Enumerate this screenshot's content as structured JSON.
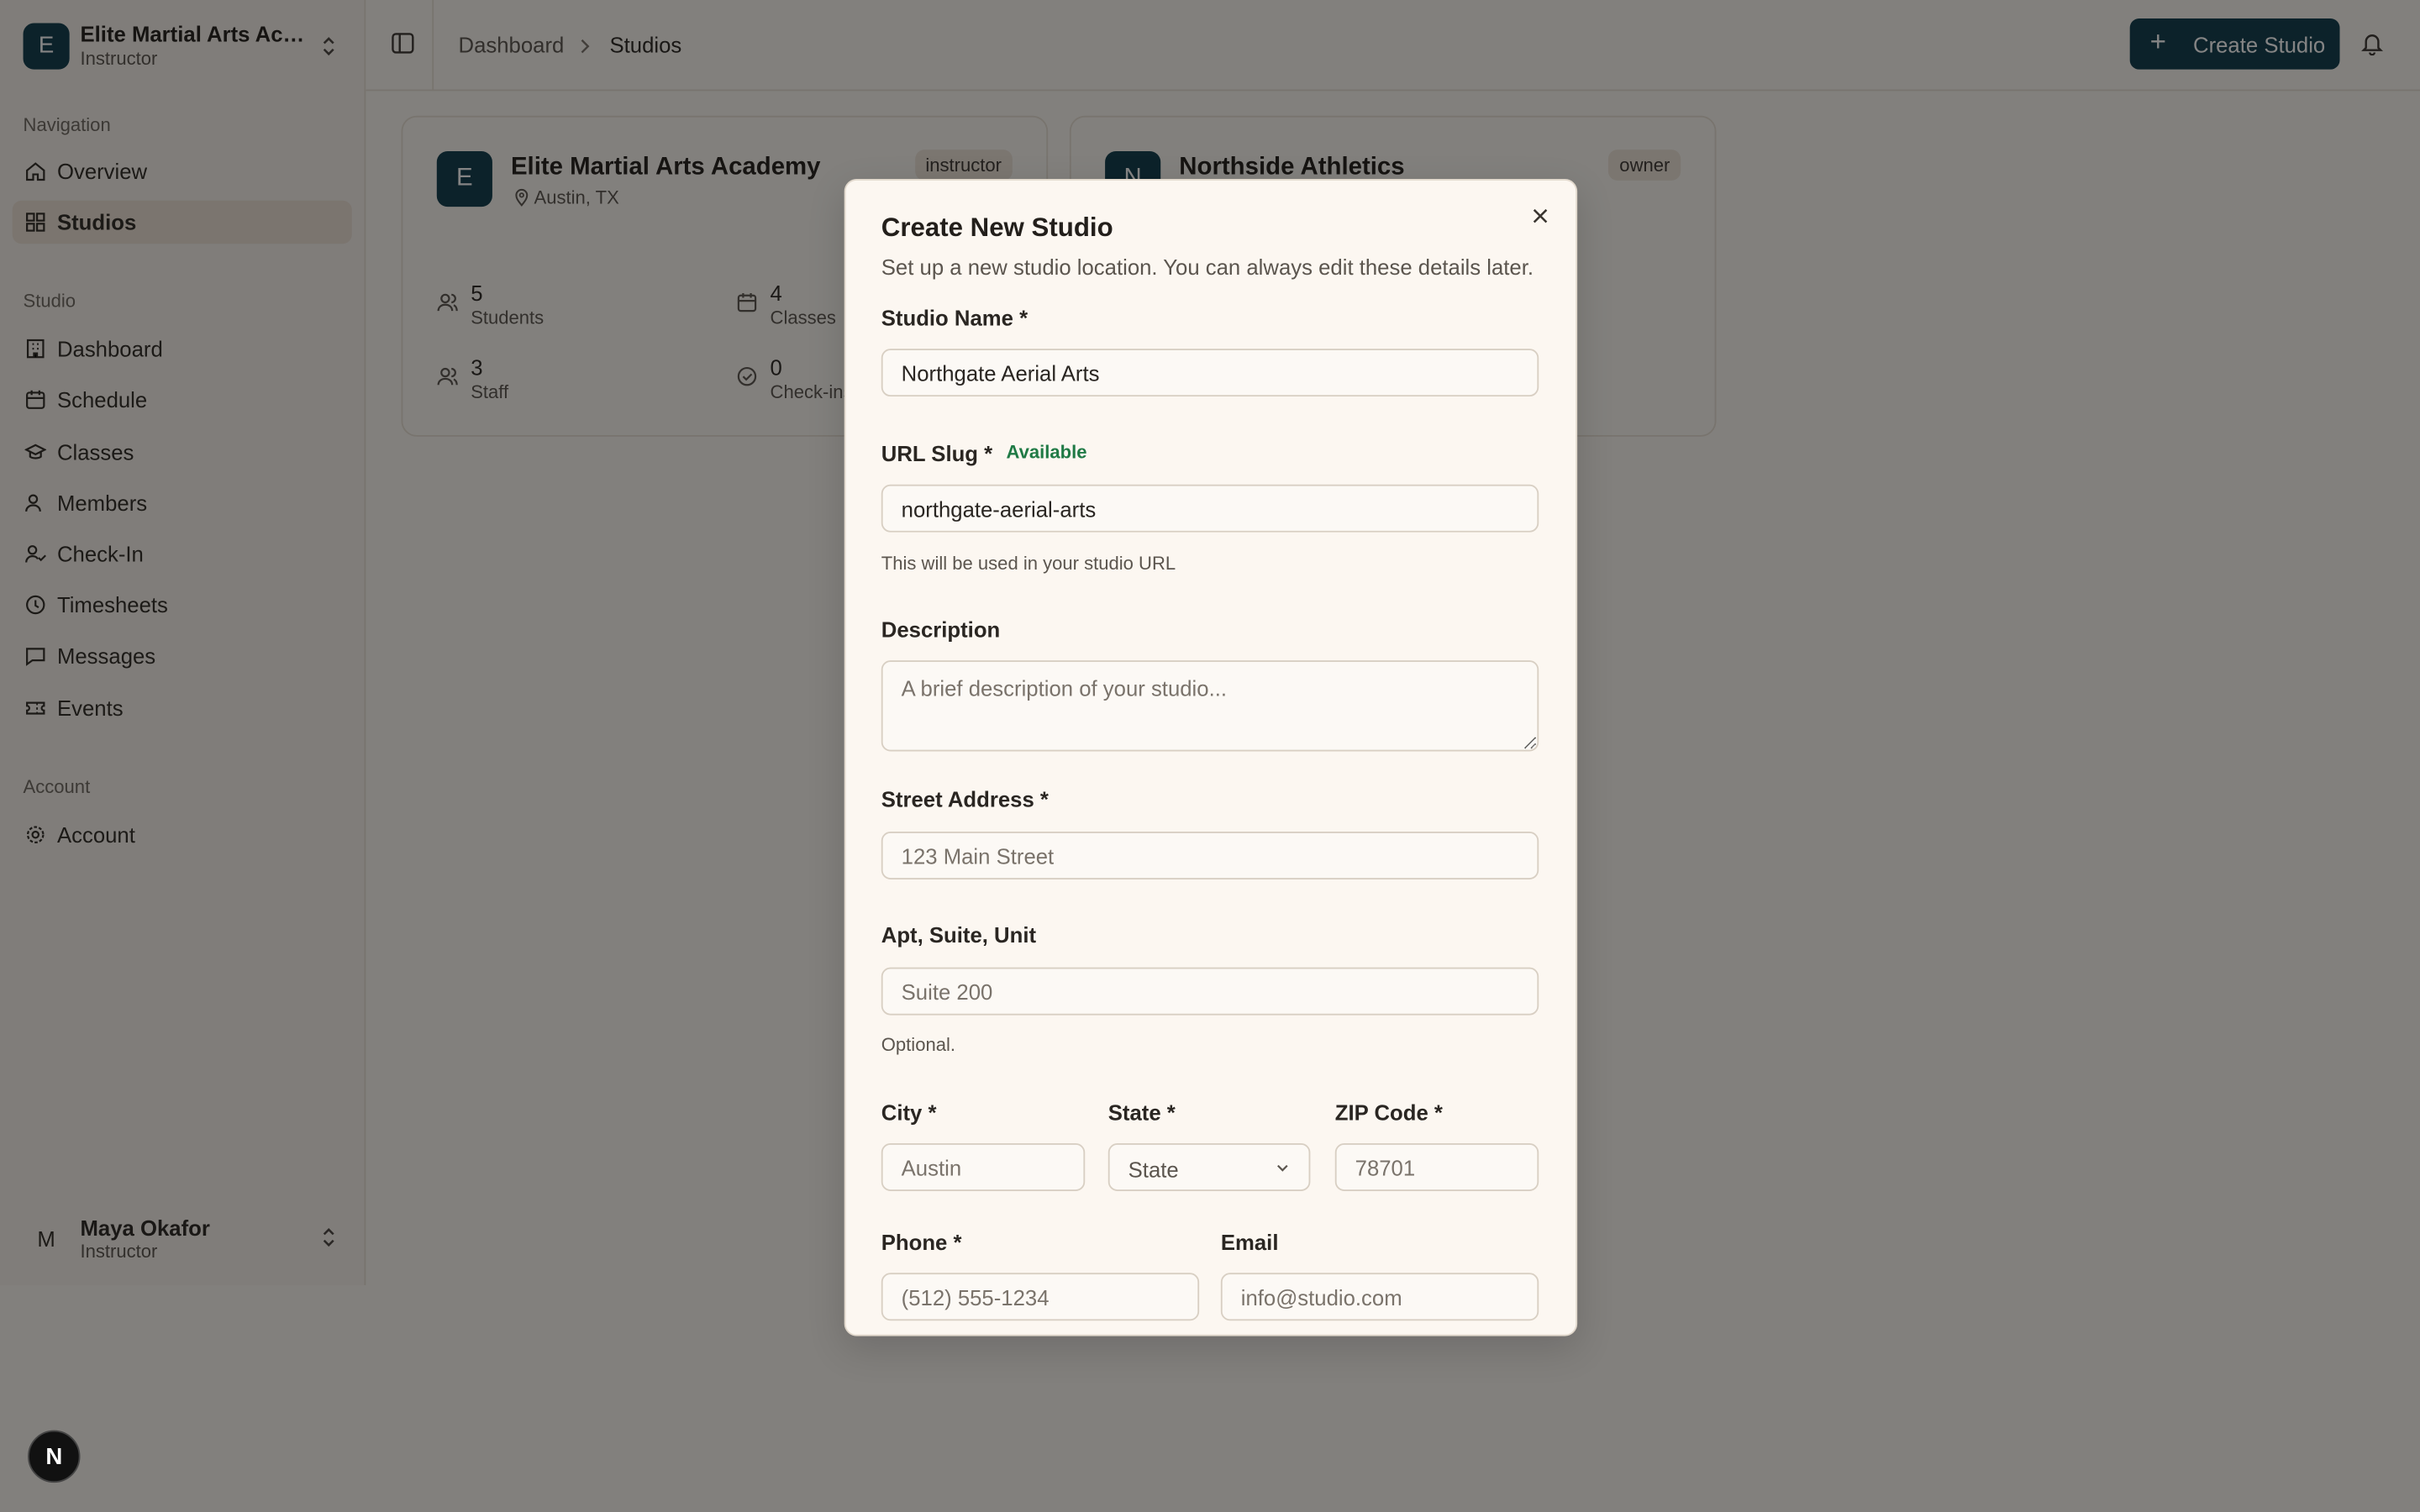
{
  "org": {
    "name": "Elite Martial Arts Aca...",
    "role": "Instructor",
    "initial": "E"
  },
  "nav": {
    "group_navigation": "Navigation",
    "overview": "Overview",
    "studios": "Studios",
    "group_studio": "Studio",
    "dashboard": "Dashboard",
    "schedule": "Schedule",
    "classes": "Classes",
    "members": "Members",
    "checkin": "Check-In",
    "timesheets": "Timesheets",
    "messages": "Messages",
    "events": "Events",
    "group_account": "Account",
    "account": "Account"
  },
  "user": {
    "name": "Maya Okafor",
    "role": "Instructor",
    "initial": "M"
  },
  "breadcrumb": {
    "root": "Dashboard",
    "current": "Studios"
  },
  "header": {
    "create_label": "Create Studio"
  },
  "cards": [
    {
      "initial": "E",
      "title": "Elite Martial Arts Academy",
      "location": "Austin, TX",
      "badge": "instructor",
      "stats": [
        {
          "num": "5",
          "cap": "Students"
        },
        {
          "num": "4",
          "cap": "Classes"
        },
        {
          "num": "3",
          "cap": "Staff"
        },
        {
          "num": "0",
          "cap": "Check-ins"
        }
      ]
    },
    {
      "initial": "N",
      "title": "Northside Athletics",
      "badge": "owner"
    }
  ],
  "modal": {
    "title": "Create New Studio",
    "subtitle": "Set up a new studio location. You can always edit these details later.",
    "name_label": "Studio Name *",
    "name_value": "Northgate Aerial Arts",
    "slug_label": "URL Slug *",
    "slug_status": "Available",
    "slug_value": "northgate-aerial-arts",
    "slug_hint": "This will be used in your studio URL",
    "desc_label": "Description",
    "desc_placeholder": "A brief description of your studio...",
    "street_label": "Street Address *",
    "street_placeholder": "123 Main Street",
    "apt_label": "Apt, Suite, Unit",
    "apt_placeholder": "Suite 200",
    "apt_hint": "Optional.",
    "city_label": "City *",
    "city_placeholder": "Austin",
    "state_label": "State *",
    "state_value": "State",
    "zip_label": "ZIP Code *",
    "zip_placeholder": "78701",
    "phone_label": "Phone *",
    "phone_placeholder": "(512) 555-1234",
    "email_label": "Email",
    "email_placeholder": "info@studio.com"
  },
  "dev_badge": "N",
  "colors": {
    "brand": "#0f3b4a",
    "available": "#1f7a45",
    "background": "#fbf7f1"
  }
}
